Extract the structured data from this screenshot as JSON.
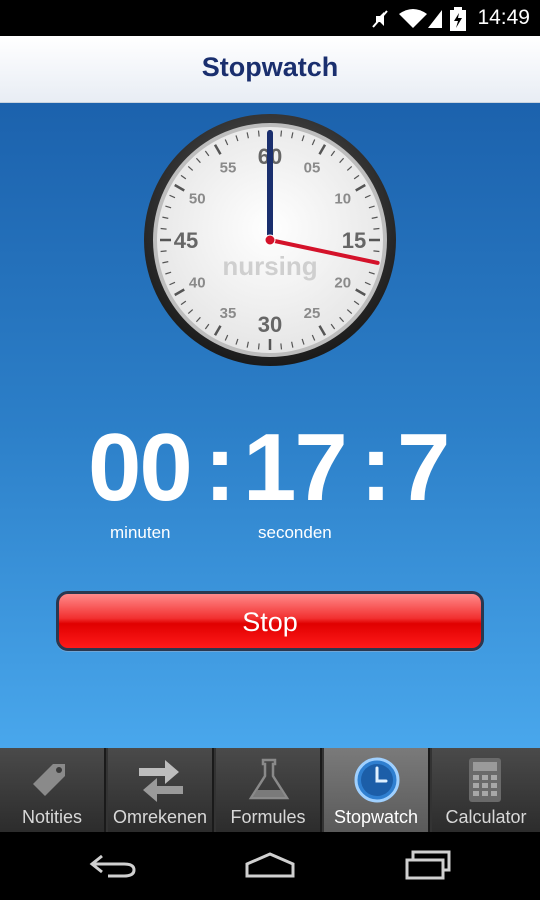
{
  "status_bar": {
    "time": "14:49"
  },
  "header": {
    "title": "Stopwatch"
  },
  "clock": {
    "brand_text": "nursing",
    "major_labels": [
      "60",
      "15",
      "30",
      "45"
    ],
    "minor_labels": [
      "05",
      "10",
      "20",
      "25",
      "35",
      "40",
      "50",
      "55"
    ],
    "minute_hand_value": 0,
    "second_hand_value": 17
  },
  "timer": {
    "minutes": "00",
    "seconds": "17",
    "tenths": "7",
    "separator": ":",
    "minutes_label": "minuten",
    "seconds_label": "seconden"
  },
  "stop_button": {
    "label": "Stop"
  },
  "tabs": [
    {
      "label": "Notities",
      "icon": "tag-icon",
      "active": false
    },
    {
      "label": "Omrekenen",
      "icon": "arrows-swap-icon",
      "active": false
    },
    {
      "label": "Formules",
      "icon": "flask-icon",
      "active": false
    },
    {
      "label": "Stopwatch",
      "icon": "clock-icon",
      "active": true
    },
    {
      "label": "Calculator",
      "icon": "calculator-icon",
      "active": false
    }
  ],
  "colors": {
    "header_title": "#1a2f6e",
    "background_top": "#1c62ad",
    "background_bottom": "#49a7ec",
    "stop_button": "#e00000",
    "second_hand": "#d4122a",
    "minute_hand": "#1a2f6e"
  },
  "nav_icons": [
    "back-icon",
    "home-icon",
    "recent-apps-icon"
  ]
}
